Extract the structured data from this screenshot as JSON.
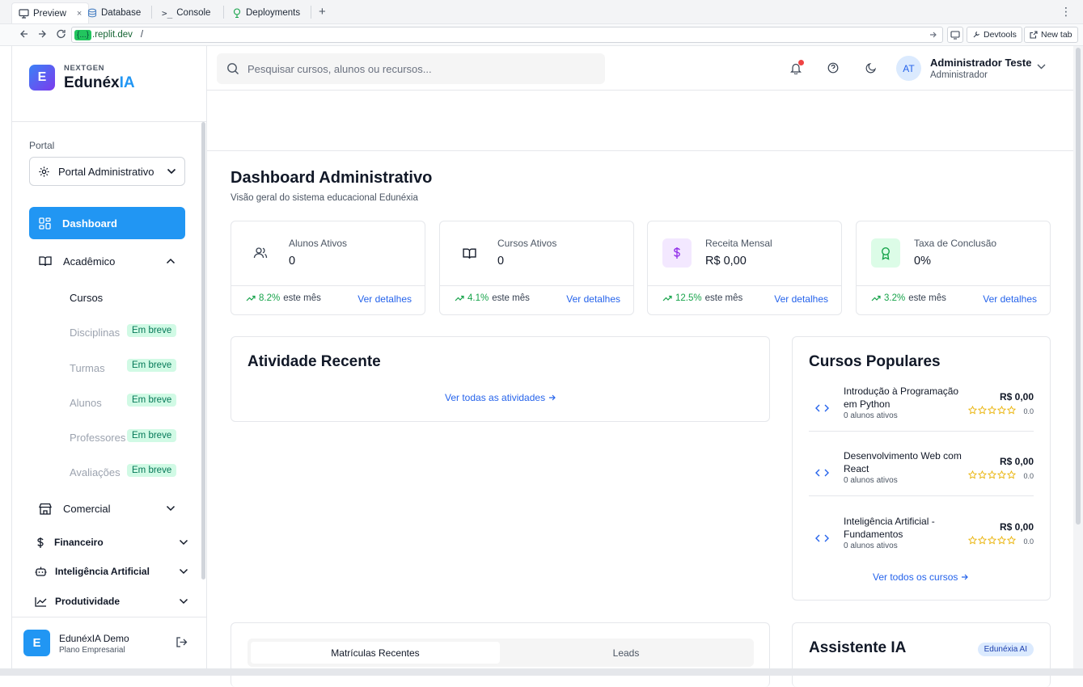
{
  "browser": {
    "tabs": [
      {
        "label": "Preview",
        "icon": "monitor-icon"
      },
      {
        "label": "Database",
        "icon": "database-icon"
      },
      {
        "label": "Console",
        "icon": "terminal-icon"
      },
      {
        "label": "Deployments",
        "icon": "deploy-icon"
      }
    ],
    "tab_close": "×",
    "new_tab_symbol": "+",
    "menu_symbol": "⋮",
    "url_host": "{...}",
    "url_domain": ".replit.dev",
    "url_path": "/",
    "devtools_label": "Devtools",
    "newtab_label": "New tab"
  },
  "sidebar": {
    "logo_letter": "E",
    "brand_top": "NEXTGEN",
    "brand_name_a": "Edunéx",
    "brand_name_b": "IA",
    "portal_label": "Portal",
    "portal_value": "Portal Administrativo",
    "nav": {
      "dashboard": "Dashboard",
      "academico": "Acadêmico",
      "comercial": "Comercial",
      "financeiro": "Financeiro",
      "ia": "Inteligência Artificial",
      "produtividade": "Produtividade"
    },
    "sub": {
      "cursos": "Cursos",
      "disciplinas": "Disciplinas",
      "turmas": "Turmas",
      "alunos": "Alunos",
      "professores": "Professores",
      "avaliacoes": "Avaliações"
    },
    "soon_badge": "Em breve",
    "footer": {
      "logo_letter": "E",
      "name": "EdunéxIA Demo",
      "plan": "Plano Empresarial"
    }
  },
  "header": {
    "search_placeholder": "Pesquisar cursos, alunos ou recursos...",
    "avatar_initials": "AT",
    "user_name": "Administrador Teste",
    "user_role": "Administrador"
  },
  "main": {
    "title": "Dashboard Administrativo",
    "subtitle": "Visão geral do sistema educacional Edunéxia",
    "stats": [
      {
        "label": "Alunos Ativos",
        "value": "0",
        "trend": "8.2%",
        "trend_suffix": "este mês",
        "link": "Ver detalhes",
        "icon": "users-icon"
      },
      {
        "label": "Cursos Ativos",
        "value": "0",
        "trend": "4.1%",
        "trend_suffix": "este mês",
        "link": "Ver detalhes",
        "icon": "book-icon"
      },
      {
        "label": "Receita Mensal",
        "value": "R$ 0,00",
        "trend": "12.5%",
        "trend_suffix": "este mês",
        "link": "Ver detalhes",
        "icon": "dollar-icon"
      },
      {
        "label": "Taxa de Conclusão",
        "value": "0%",
        "trend": "3.2%",
        "trend_suffix": "este mês",
        "link": "Ver detalhes",
        "icon": "award-icon"
      }
    ],
    "activity": {
      "title": "Atividade Recente",
      "link": "Ver todas as atividades"
    },
    "popular": {
      "title": "Cursos Populares",
      "courses": [
        {
          "name": "Introdução à Programação em Python",
          "students": "0 alunos ativos",
          "price": "R$ 0,00",
          "rating": "0.0",
          "stars": 0
        },
        {
          "name": "Desenvolvimento Web com React",
          "students": "0 alunos ativos",
          "price": "R$ 0,00",
          "rating": "0.0",
          "stars": 0
        },
        {
          "name": "Inteligência Artificial - Fundamentos",
          "students": "0 alunos ativos",
          "price": "R$ 0,00",
          "rating": "0.0",
          "stars": 0
        }
      ],
      "link": "Ver todos os cursos"
    },
    "enroll_tabs": [
      "Matrículas Recentes",
      "Leads"
    ],
    "assistant": {
      "title": "Assistente IA",
      "badge": "Edunéxia AI"
    }
  },
  "colors": {
    "primary": "#2196f3",
    "trend_up": "#16a34a",
    "link": "#2563eb",
    "soon_bg": "#d1fae5",
    "soon_text": "#047857",
    "notification_dot": "#ef4444",
    "star": "#eab308"
  }
}
